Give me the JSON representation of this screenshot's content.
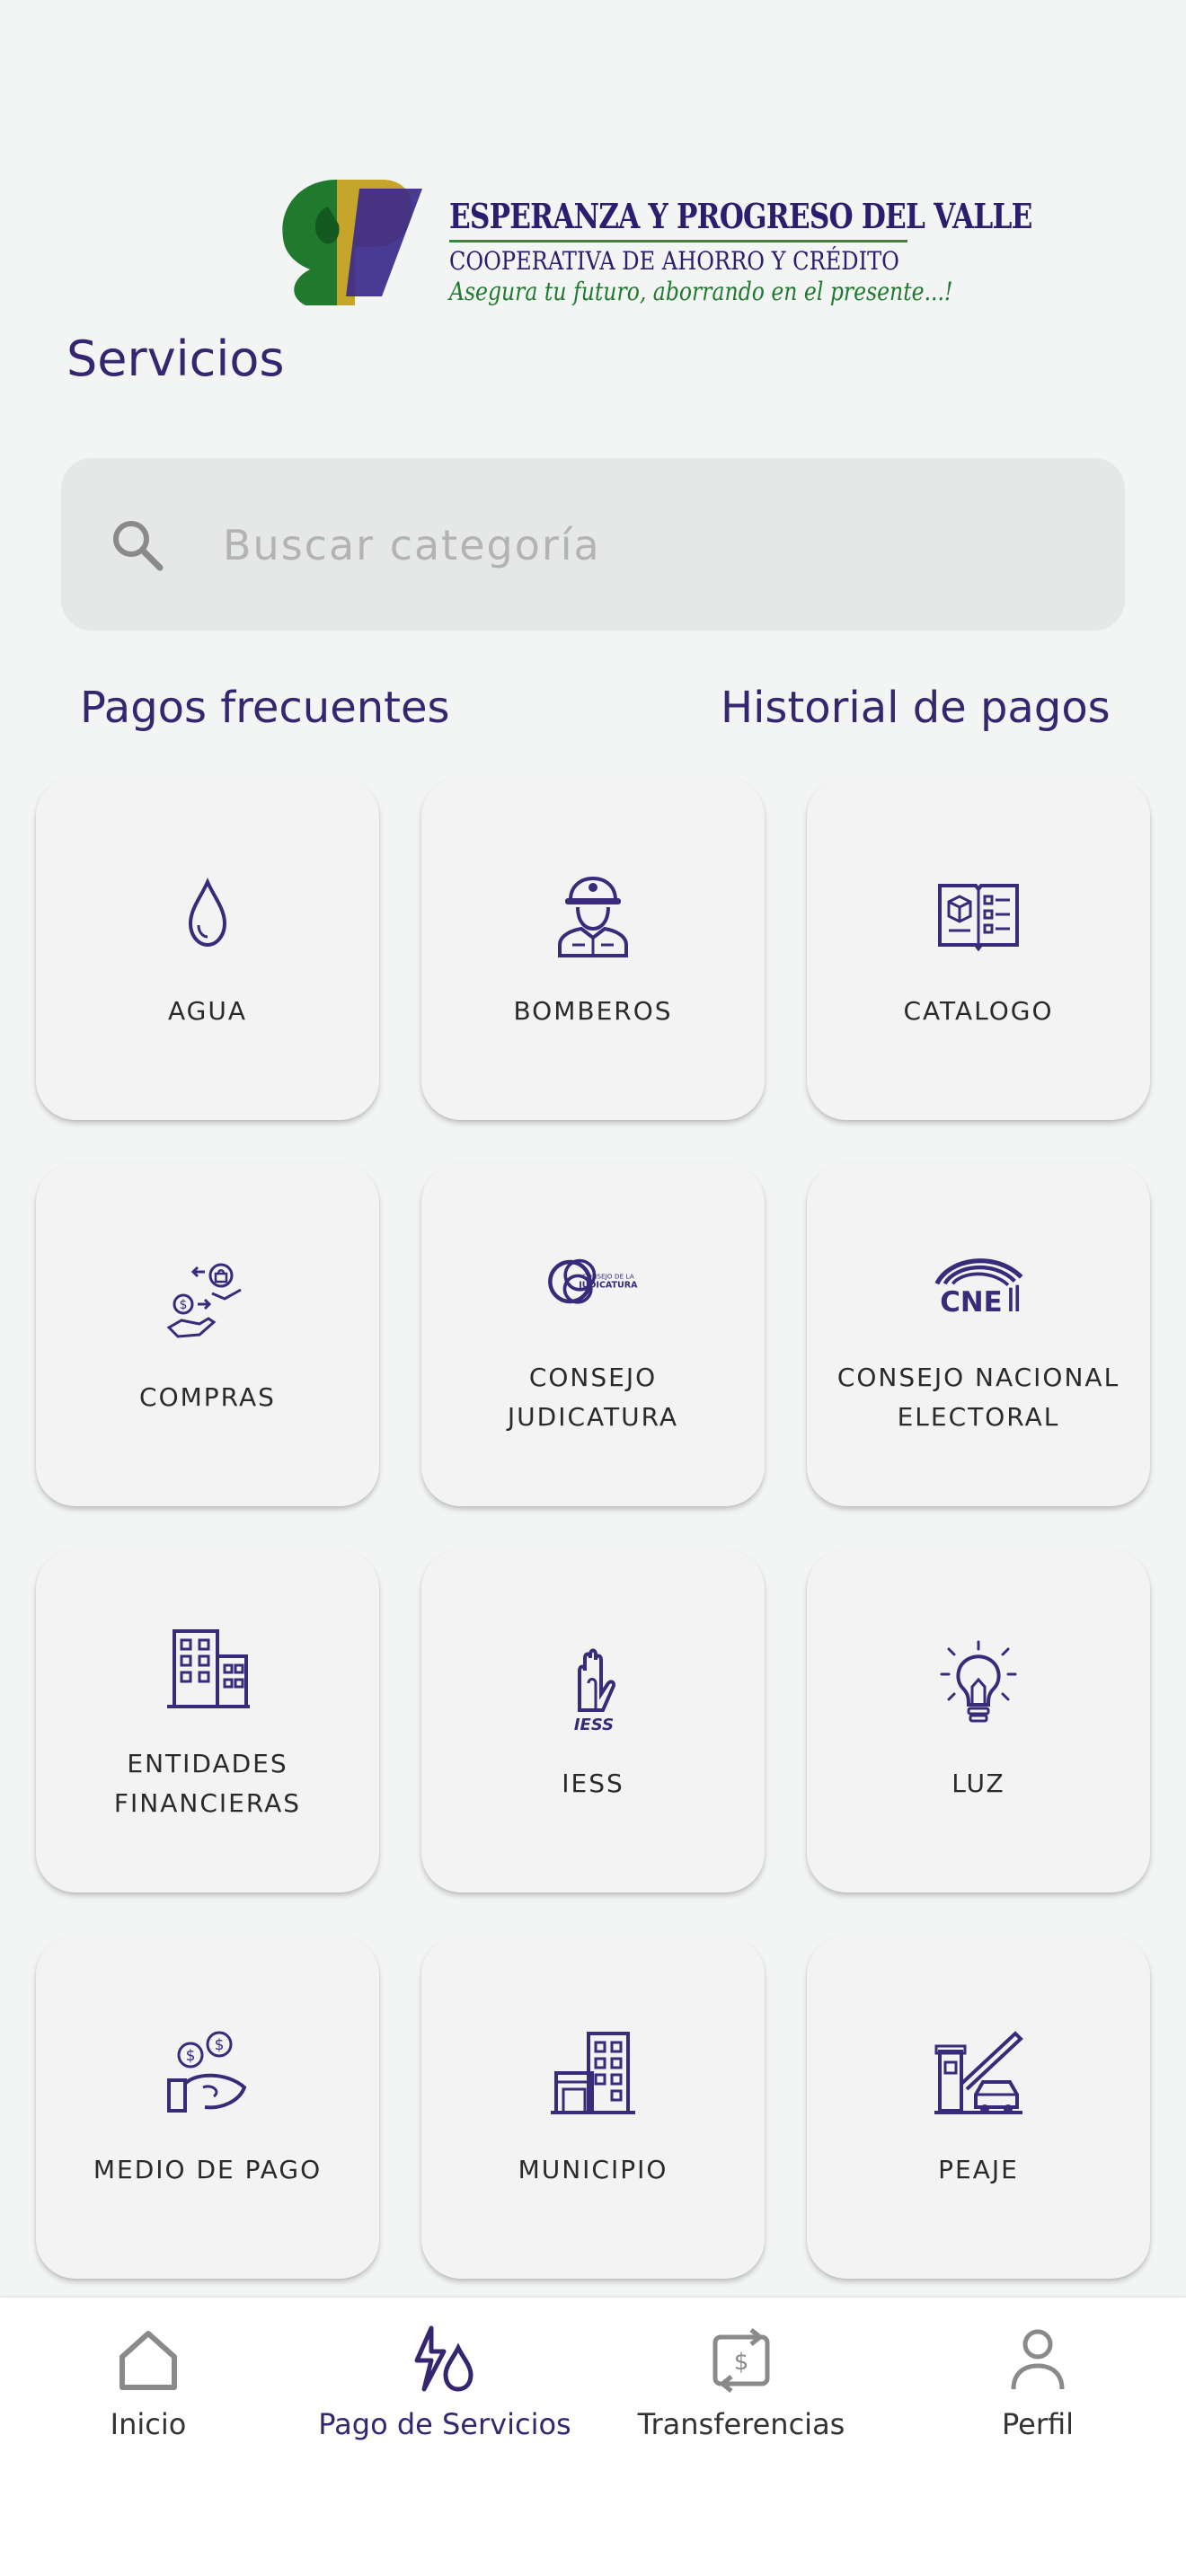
{
  "header": {
    "logo_name": "ESPERANZA Y PROGRESO DEL VALLE",
    "logo_subtitle": "COOPERATIVA DE AHORRO Y CRÉDITO",
    "logo_slogan": "Asegura tu futuro, aborrando en el presente...!",
    "page_title": "Servicios"
  },
  "search": {
    "placeholder": "Buscar categoría",
    "value": ""
  },
  "links": {
    "frequent": "Pagos frecuentes",
    "history": "Historial de pagos"
  },
  "categories": [
    {
      "label": "AGUA",
      "icon": "water-drop-icon"
    },
    {
      "label": "BOMBEROS",
      "icon": "firefighter-icon"
    },
    {
      "label": "CATALOGO",
      "icon": "catalog-book-icon"
    },
    {
      "label": "COMPRAS",
      "icon": "purchase-exchange-icon"
    },
    {
      "label": "CONSEJO\nJUDICATURA",
      "icon": "consejo-judicatura-logo-icon"
    },
    {
      "label": "CONSEJO NACIONAL\nELECTORAL",
      "icon": "cne-logo-icon"
    },
    {
      "label": "ENTIDADES\nFINANCIERAS",
      "icon": "bank-building-icon"
    },
    {
      "label": "IESS",
      "icon": "iess-logo-icon"
    },
    {
      "label": "LUZ",
      "icon": "light-bulb-icon"
    },
    {
      "label": "MEDIO DE PAGO",
      "icon": "payment-hand-coins-icon"
    },
    {
      "label": "MUNICIPIO",
      "icon": "municipal-building-icon"
    },
    {
      "label": "PEAJE",
      "icon": "toll-booth-icon"
    }
  ],
  "tabbar": {
    "items": [
      {
        "label": "Inicio",
        "icon": "home-icon",
        "active": false
      },
      {
        "label": "Pago de Servicios",
        "icon": "services-bolt-drop-icon",
        "active": true
      },
      {
        "label": "Transferencias",
        "icon": "transfer-dollar-icon",
        "active": false
      },
      {
        "label": "Perfil",
        "icon": "profile-person-icon",
        "active": false
      }
    ]
  },
  "colors": {
    "primary": "#35266f",
    "background": "#f3f4f4",
    "card": "#f3f3f3",
    "icon_stroke": "#3a2a7a"
  }
}
